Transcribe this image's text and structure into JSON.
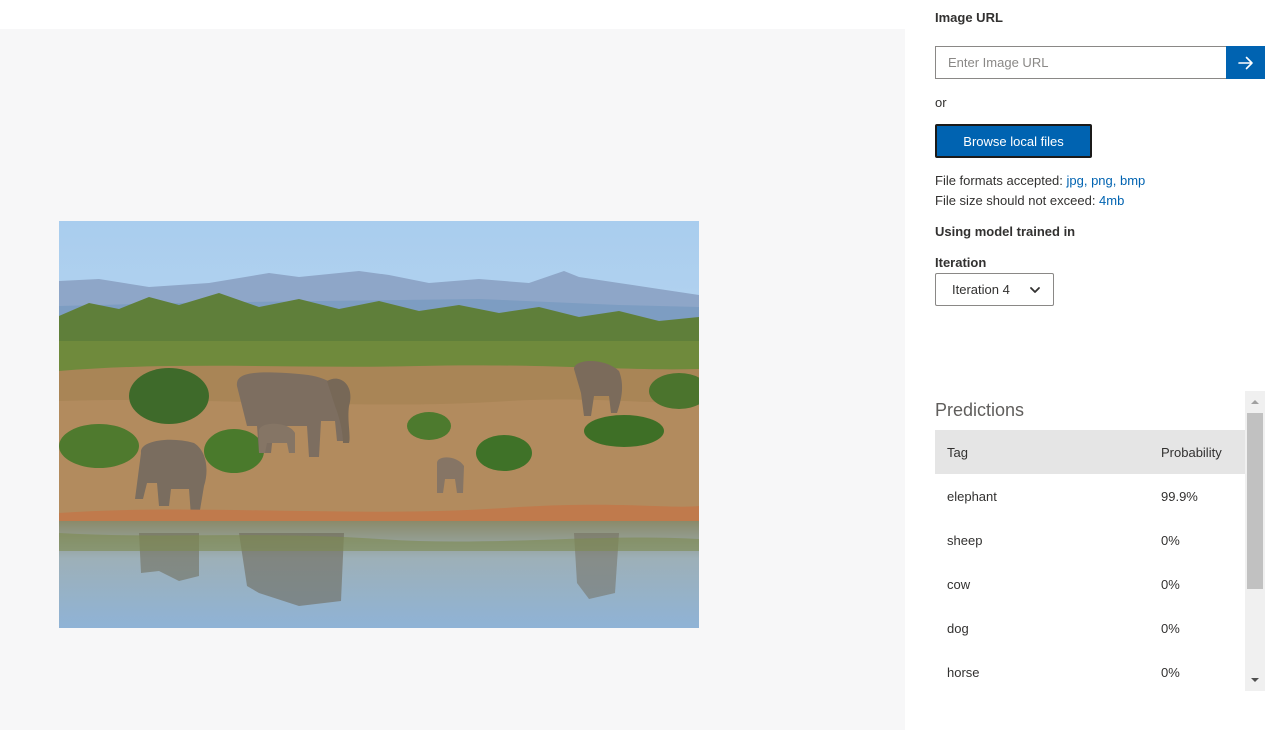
{
  "upload": {
    "image_url_label": "Image URL",
    "url_placeholder": "Enter Image URL",
    "or_text": "or",
    "browse_label": "Browse local files",
    "formats_prefix": "File formats accepted: ",
    "formats_value": "jpg, png, bmp",
    "size_prefix": "File size should not exceed: ",
    "size_value": "4mb",
    "model_label": "Using model trained in",
    "iteration_label": "Iteration",
    "iteration_selected": "Iteration 4"
  },
  "predictions": {
    "title": "Predictions",
    "columns": [
      "Tag",
      "Probability"
    ],
    "rows": [
      {
        "tag": "elephant",
        "probability": "99.9%"
      },
      {
        "tag": "sheep",
        "probability": "0%"
      },
      {
        "tag": "cow",
        "probability": "0%"
      },
      {
        "tag": "dog",
        "probability": "0%"
      },
      {
        "tag": "horse",
        "probability": "0%"
      }
    ]
  },
  "colors": {
    "accent": "#0063b1",
    "left_background": "#f7f7f8",
    "table_header": "#e5e5e5"
  }
}
